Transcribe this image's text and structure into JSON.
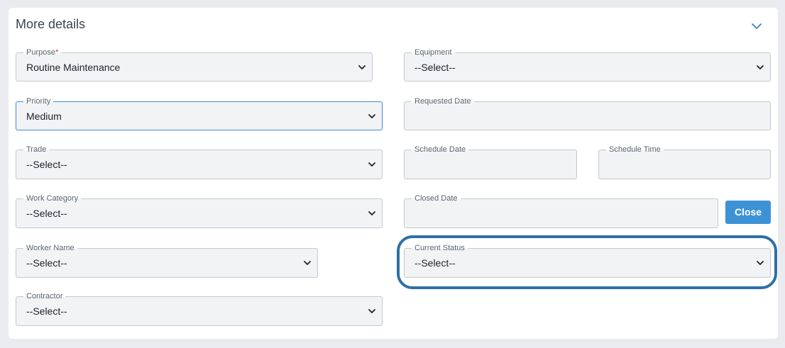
{
  "section": {
    "title": "More details",
    "collapse_icon": "chevron-down-icon"
  },
  "fields": {
    "purpose": {
      "label": "Purpose",
      "required_mark": "*",
      "value": "Routine Maintenance"
    },
    "equipment": {
      "label": "Equipment",
      "value": "--Select--"
    },
    "priority": {
      "label": "Priority",
      "value": "Medium"
    },
    "requested_date": {
      "label": "Requested Date",
      "value": ""
    },
    "trade": {
      "label": "Trade",
      "value": "--Select--"
    },
    "schedule_date": {
      "label": "Schedule Date",
      "value": ""
    },
    "schedule_time": {
      "label": "Schedule Time",
      "value": ""
    },
    "work_category": {
      "label": "Work Category",
      "value": "--Select--"
    },
    "closed_date": {
      "label": "Closed Date",
      "value": ""
    },
    "worker_name": {
      "label": "Worker Name",
      "value": "--Select--"
    },
    "current_status": {
      "label": "Current Status",
      "value": "--Select--"
    },
    "contractor": {
      "label": "Contractor",
      "value": "--Select--"
    }
  },
  "buttons": {
    "close_label": "Close"
  },
  "colors": {
    "accent": "#3d92d6",
    "highlight_ring": "#2f6fa6",
    "field_bg": "#f1f3f5",
    "required": "#d0342c"
  }
}
